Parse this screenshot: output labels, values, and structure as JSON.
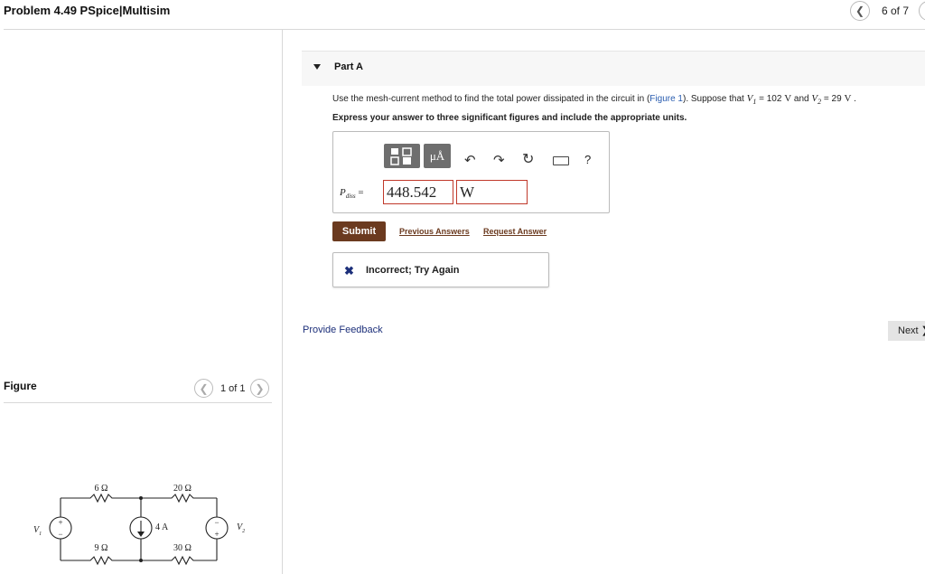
{
  "header": {
    "title": "Problem 4.49 PSpice|Multisim",
    "pagination": "6 of 7"
  },
  "part": {
    "label": "Part A",
    "question_prefix": "Use the mesh-current method to find the total power dissipated in the circuit in (",
    "figure_link": "Figure 1",
    "question_mid": "). Suppose that ",
    "v1_symbol": "V",
    "v1_sub": "1",
    "v1_eq": " = 102 ",
    "v1_unit": "V",
    "and_text": " and ",
    "v2_symbol": "V",
    "v2_sub": "2",
    "v2_eq": " = 29 ",
    "v2_unit": "V",
    "period": " .",
    "instruction": "Express your answer to three significant figures and include the appropriate units."
  },
  "answer": {
    "toolbar_units_label": "μÅ",
    "toolbar_help": "?",
    "label_symbol": "P",
    "label_sub": "diss",
    "label_eq": " =",
    "value": "448.542",
    "unit": "W"
  },
  "actions": {
    "submit": "Submit",
    "previous_answers": "Previous Answers",
    "request_answer": "Request Answer"
  },
  "feedback": {
    "icon": "x-icon",
    "text": "Incorrect; Try Again",
    "color": "#1c2f7a"
  },
  "footer": {
    "provide_feedback": "Provide Feedback",
    "next": "Next ❯"
  },
  "figure": {
    "title": "Figure",
    "pagination": "1 of 1",
    "labels": {
      "r_top_left": "6 Ω",
      "r_top_right": "20 Ω",
      "r_bottom_left": "9 Ω",
      "r_bottom_right": "30 Ω",
      "current_source": "4 A",
      "v1": "V",
      "v1_sub": "1",
      "v2": "V",
      "v2_sub": "2"
    }
  },
  "colors": {
    "submit_bg": "#6b3a1f",
    "error_border": "#c0392b",
    "link": "#2a5db0"
  }
}
